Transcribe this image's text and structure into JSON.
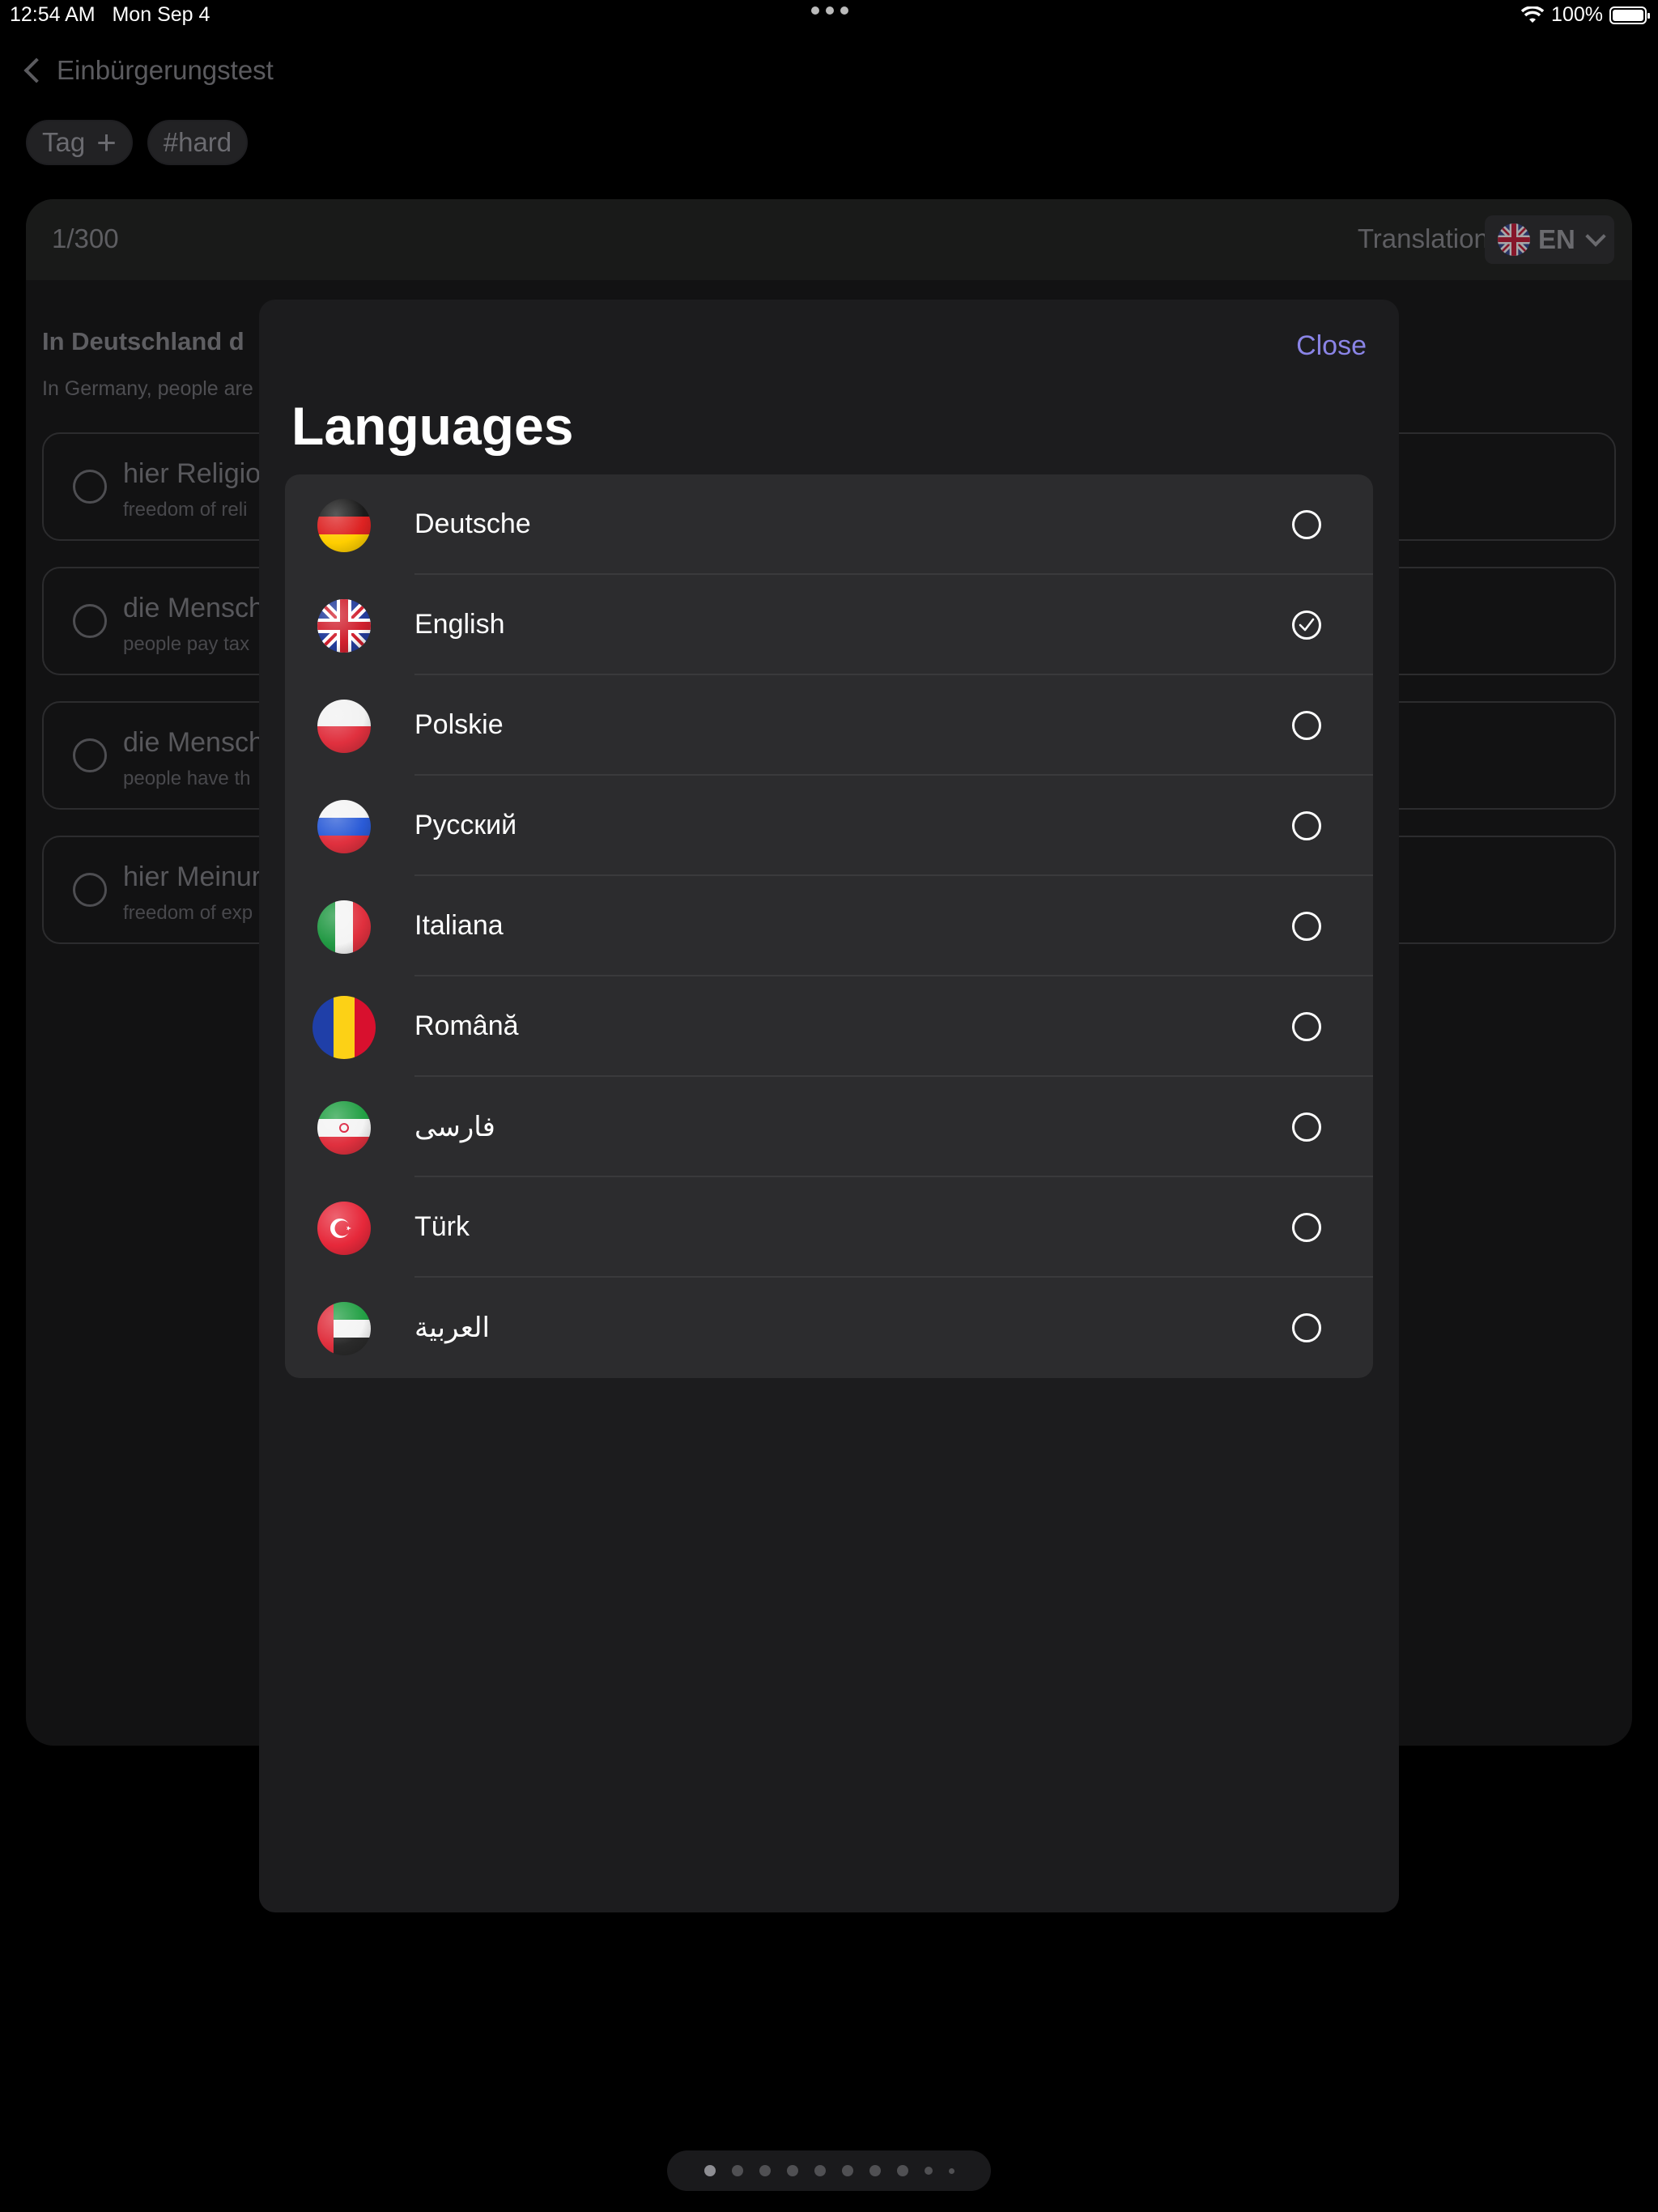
{
  "status_bar": {
    "time": "12:54 AM",
    "date": "Mon Sep 4",
    "battery": "100%",
    "battery_level": 1.0
  },
  "background": {
    "nav_back_label": "Einbürgerungstest",
    "tag_label": "Tag",
    "tag_add": "+",
    "hashtag": "#hard",
    "progress": "1/300",
    "translation_label": "Translation:",
    "translation_code": "EN",
    "question_fragment": "In Deutschland d",
    "question_translation_fragment": "In Germany, people are",
    "answers": [
      {
        "text": "hier Religio",
        "translation": "freedom of reli"
      },
      {
        "text": "die Mensch",
        "translation": "people pay tax"
      },
      {
        "text": "die Mensch",
        "translation": "people have th"
      },
      {
        "text": "hier Meinur",
        "translation": "freedom of exp"
      }
    ]
  },
  "modal": {
    "close_label": "Close",
    "title": "Languages",
    "languages": [
      {
        "name": "Deutsche",
        "flag": "germany-flag-icon",
        "selected": false
      },
      {
        "name": "English",
        "flag": "uk-flag-icon",
        "selected": true
      },
      {
        "name": "Polskie",
        "flag": "poland-flag-icon",
        "selected": false
      },
      {
        "name": "Русский",
        "flag": "russia-flag-icon",
        "selected": false
      },
      {
        "name": "Italiana",
        "flag": "italy-flag-icon",
        "selected": false
      },
      {
        "name": "Română",
        "flag": "romania-flag-icon",
        "selected": false
      },
      {
        "name": "فارسی",
        "flag": "iran-flag-icon",
        "selected": false
      },
      {
        "name": "Türk",
        "flag": "turkey-flag-icon",
        "selected": false
      },
      {
        "name": "العربية",
        "flag": "uae-flag-icon",
        "selected": false
      }
    ]
  },
  "pager": {
    "pages": 10,
    "current": 1
  },
  "colors": {
    "accent": "#8a84e6",
    "modal_bg": "#1c1c1e",
    "list_bg": "#2c2c2e"
  }
}
